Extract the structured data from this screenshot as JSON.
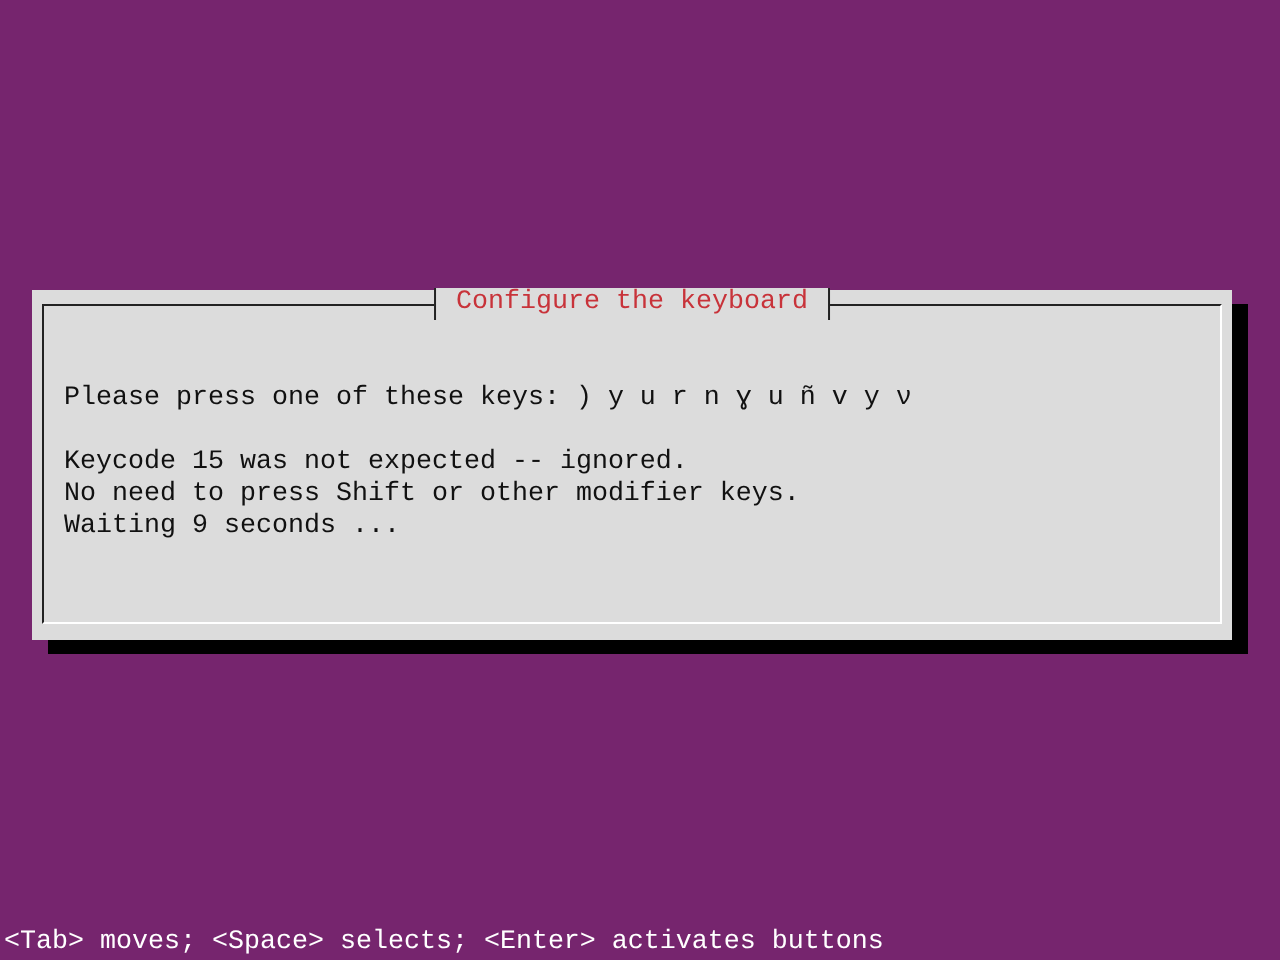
{
  "dialog": {
    "title": "Configure the keyboard",
    "prompt": "Please press one of these keys: ) y u r n ɣ u ñ v y ν",
    "lines": [
      "Keycode 15 was not expected -- ignored.",
      "No need to press Shift or other modifier keys.",
      "Waiting 9 seconds ..."
    ]
  },
  "status_bar": "<Tab> moves; <Space> selects; <Enter> activates buttons"
}
